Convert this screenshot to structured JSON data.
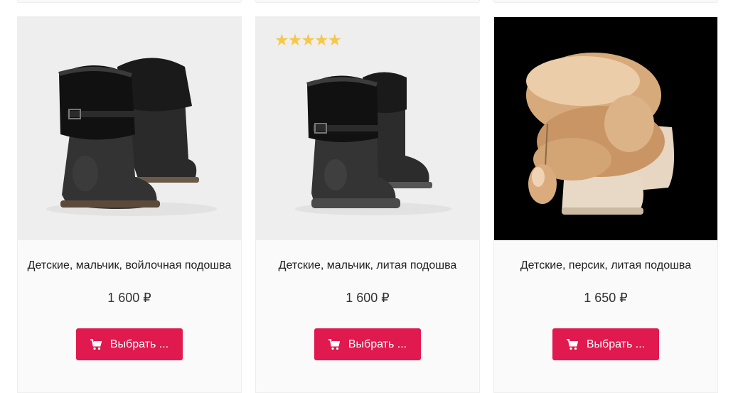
{
  "products": [
    {
      "title": "Детские, мальчик, войлочная подошва",
      "price": "1 600 ₽",
      "button_label": "Выбрать ...",
      "image_icon": "black-fur-boots-felt-sole",
      "image_background": "#eeeeee"
    },
    {
      "title": "Детские, мальчик, литая подошва",
      "price": "1 600 ₽",
      "button_label": "Выбрать ...",
      "rating_stars": "★★★★★",
      "rating_value": 5,
      "image_icon": "black-fur-boots-molded-sole",
      "image_background": "#eeeeee"
    },
    {
      "title": "Детские, персик, литая подошва",
      "price": "1 650 ₽",
      "button_label": "Выбрать ...",
      "image_icon": "peach-fur-boots",
      "image_background": "#000000"
    }
  ],
  "colors": {
    "accent": "#e0194e",
    "star": "#f5c84a",
    "card_background": "#fafafa"
  }
}
